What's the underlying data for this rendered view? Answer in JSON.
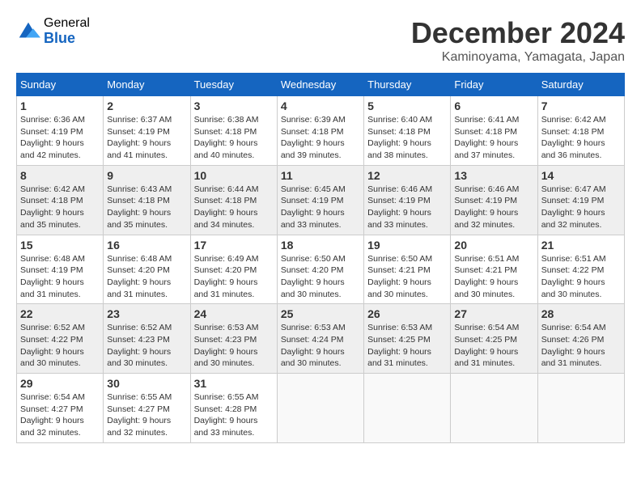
{
  "header": {
    "logo_general": "General",
    "logo_blue": "Blue",
    "month_year": "December 2024",
    "location": "Kaminoyama, Yamagata, Japan"
  },
  "days_of_week": [
    "Sunday",
    "Monday",
    "Tuesday",
    "Wednesday",
    "Thursday",
    "Friday",
    "Saturday"
  ],
  "weeks": [
    [
      {
        "day": "1",
        "sunrise": "6:36 AM",
        "sunset": "4:19 PM",
        "daylight": "9 hours and 42 minutes."
      },
      {
        "day": "2",
        "sunrise": "6:37 AM",
        "sunset": "4:19 PM",
        "daylight": "9 hours and 41 minutes."
      },
      {
        "day": "3",
        "sunrise": "6:38 AM",
        "sunset": "4:18 PM",
        "daylight": "9 hours and 40 minutes."
      },
      {
        "day": "4",
        "sunrise": "6:39 AM",
        "sunset": "4:18 PM",
        "daylight": "9 hours and 39 minutes."
      },
      {
        "day": "5",
        "sunrise": "6:40 AM",
        "sunset": "4:18 PM",
        "daylight": "9 hours and 38 minutes."
      },
      {
        "day": "6",
        "sunrise": "6:41 AM",
        "sunset": "4:18 PM",
        "daylight": "9 hours and 37 minutes."
      },
      {
        "day": "7",
        "sunrise": "6:42 AM",
        "sunset": "4:18 PM",
        "daylight": "9 hours and 36 minutes."
      }
    ],
    [
      {
        "day": "8",
        "sunrise": "6:42 AM",
        "sunset": "4:18 PM",
        "daylight": "9 hours and 35 minutes."
      },
      {
        "day": "9",
        "sunrise": "6:43 AM",
        "sunset": "4:18 PM",
        "daylight": "9 hours and 35 minutes."
      },
      {
        "day": "10",
        "sunrise": "6:44 AM",
        "sunset": "4:18 PM",
        "daylight": "9 hours and 34 minutes."
      },
      {
        "day": "11",
        "sunrise": "6:45 AM",
        "sunset": "4:19 PM",
        "daylight": "9 hours and 33 minutes."
      },
      {
        "day": "12",
        "sunrise": "6:46 AM",
        "sunset": "4:19 PM",
        "daylight": "9 hours and 33 minutes."
      },
      {
        "day": "13",
        "sunrise": "6:46 AM",
        "sunset": "4:19 PM",
        "daylight": "9 hours and 32 minutes."
      },
      {
        "day": "14",
        "sunrise": "6:47 AM",
        "sunset": "4:19 PM",
        "daylight": "9 hours and 32 minutes."
      }
    ],
    [
      {
        "day": "15",
        "sunrise": "6:48 AM",
        "sunset": "4:19 PM",
        "daylight": "9 hours and 31 minutes."
      },
      {
        "day": "16",
        "sunrise": "6:48 AM",
        "sunset": "4:20 PM",
        "daylight": "9 hours and 31 minutes."
      },
      {
        "day": "17",
        "sunrise": "6:49 AM",
        "sunset": "4:20 PM",
        "daylight": "9 hours and 31 minutes."
      },
      {
        "day": "18",
        "sunrise": "6:50 AM",
        "sunset": "4:20 PM",
        "daylight": "9 hours and 30 minutes."
      },
      {
        "day": "19",
        "sunrise": "6:50 AM",
        "sunset": "4:21 PM",
        "daylight": "9 hours and 30 minutes."
      },
      {
        "day": "20",
        "sunrise": "6:51 AM",
        "sunset": "4:21 PM",
        "daylight": "9 hours and 30 minutes."
      },
      {
        "day": "21",
        "sunrise": "6:51 AM",
        "sunset": "4:22 PM",
        "daylight": "9 hours and 30 minutes."
      }
    ],
    [
      {
        "day": "22",
        "sunrise": "6:52 AM",
        "sunset": "4:22 PM",
        "daylight": "9 hours and 30 minutes."
      },
      {
        "day": "23",
        "sunrise": "6:52 AM",
        "sunset": "4:23 PM",
        "daylight": "9 hours and 30 minutes."
      },
      {
        "day": "24",
        "sunrise": "6:53 AM",
        "sunset": "4:23 PM",
        "daylight": "9 hours and 30 minutes."
      },
      {
        "day": "25",
        "sunrise": "6:53 AM",
        "sunset": "4:24 PM",
        "daylight": "9 hours and 30 minutes."
      },
      {
        "day": "26",
        "sunrise": "6:53 AM",
        "sunset": "4:25 PM",
        "daylight": "9 hours and 31 minutes."
      },
      {
        "day": "27",
        "sunrise": "6:54 AM",
        "sunset": "4:25 PM",
        "daylight": "9 hours and 31 minutes."
      },
      {
        "day": "28",
        "sunrise": "6:54 AM",
        "sunset": "4:26 PM",
        "daylight": "9 hours and 31 minutes."
      }
    ],
    [
      {
        "day": "29",
        "sunrise": "6:54 AM",
        "sunset": "4:27 PM",
        "daylight": "9 hours and 32 minutes."
      },
      {
        "day": "30",
        "sunrise": "6:55 AM",
        "sunset": "4:27 PM",
        "daylight": "9 hours and 32 minutes."
      },
      {
        "day": "31",
        "sunrise": "6:55 AM",
        "sunset": "4:28 PM",
        "daylight": "9 hours and 33 minutes."
      },
      null,
      null,
      null,
      null
    ]
  ],
  "labels": {
    "sunrise": "Sunrise: ",
    "sunset": "Sunset: ",
    "daylight": "Daylight: "
  }
}
